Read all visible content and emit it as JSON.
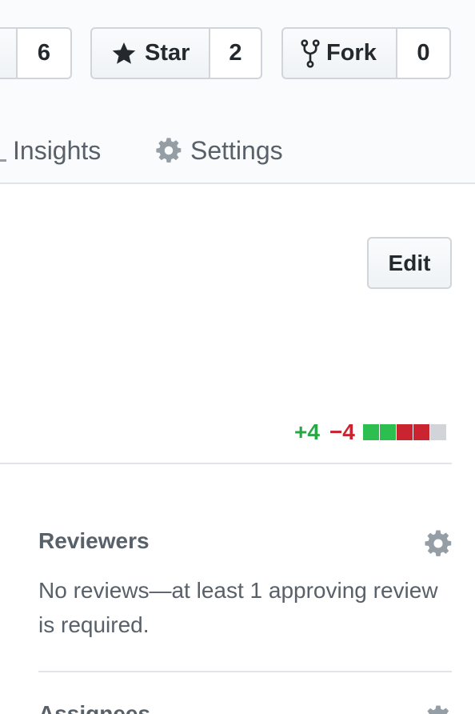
{
  "repo_actions": {
    "watch": {
      "count": "6"
    },
    "star": {
      "label": "Star",
      "count": "2"
    },
    "fork": {
      "label": "Fork",
      "count": "0"
    }
  },
  "tabs": [
    {
      "label": "Insights",
      "icon": "graph-icon"
    },
    {
      "label": "Settings",
      "icon": "gear-icon"
    }
  ],
  "pull_request": {
    "edit_label": "Edit",
    "diffstat": {
      "additions": "+4",
      "deletions": "−4",
      "blocks": [
        "#2cbe4e",
        "#2cbe4e",
        "#cb2431",
        "#cb2431",
        "#d1d5da"
      ]
    }
  },
  "sidebar": {
    "reviewers": {
      "title": "Reviewers",
      "description": "No reviews—at least 1 approving review is required."
    },
    "assignees": {
      "title": "Assignees"
    }
  },
  "colors": {
    "addition": "#28a745",
    "deletion": "#cb2431",
    "muted_text": "#586069",
    "border": "#e1e4e8"
  }
}
